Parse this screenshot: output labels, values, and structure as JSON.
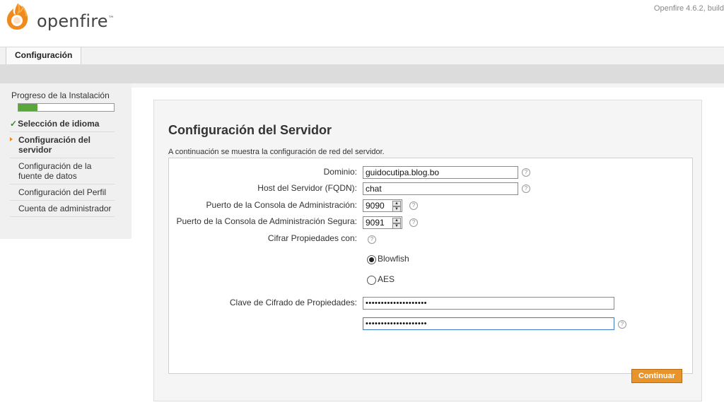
{
  "header": {
    "logo_text": "openfire",
    "logo_tm": "™",
    "version": "Openfire 4.6.2, build"
  },
  "tabs": [
    {
      "label": "Configuración"
    }
  ],
  "sidebar": {
    "progress_title": "Progreso de la Instalación",
    "progress_fraction": 0.2,
    "steps": [
      {
        "label": "Selección de idioma",
        "state": "done"
      },
      {
        "label": "Configuración del servidor",
        "state": "current"
      },
      {
        "label": "Configuración de la fuente de datos",
        "state": "pending"
      },
      {
        "label": "Configuración del Perfil",
        "state": "pending"
      },
      {
        "label": "Cuenta de administrador",
        "state": "pending"
      }
    ]
  },
  "main": {
    "title": "Configuración del Servidor",
    "description": "A continuación se muestra la configuración de red del servidor.",
    "fields": {
      "domain_label": "Dominio:",
      "domain_value": "guidocutipa.blog.bo",
      "fqdn_label": "Host del Servidor (FQDN):",
      "fqdn_value": "chat",
      "admin_port_label": "Puerto de la Consola de Administración:",
      "admin_port_value": "9090",
      "secure_port_label": "Puerto de la Consola de Administración Segura:",
      "secure_port_value": "9091",
      "encrypt_label": "Cifrar Propiedades con:",
      "encrypt_options": [
        "Blowfish",
        "AES"
      ],
      "encrypt_selected": "Blowfish",
      "key_label": "Clave de Cifrado de Propiedades:",
      "key_value": "••••••••••••••••••••",
      "key_confirm_value": "••••••••••••••••••••"
    },
    "help_glyph": "?",
    "continue_label": "Continuar"
  },
  "colors": {
    "accent": "#e8942c",
    "progress": "#5aa53c",
    "brand": "#f08a1c"
  }
}
